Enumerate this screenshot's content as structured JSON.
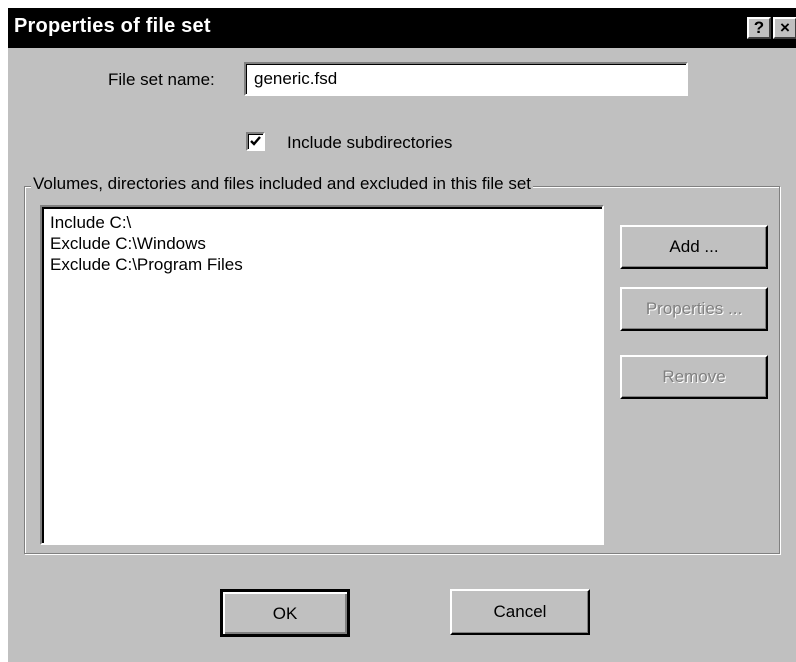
{
  "window": {
    "title": "Properties of file set",
    "help_label": "?",
    "close_label": "×"
  },
  "file_set_name": {
    "label": "File set name:",
    "value": "generic.fsd"
  },
  "include_subdirectories": {
    "label": "Include subdirectories",
    "checked": true
  },
  "group": {
    "legend": "Volumes, directories and files included and excluded in this file set",
    "items": [
      "Include C:\\",
      "Exclude C:\\Windows",
      "Exclude C:\\Program Files"
    ]
  },
  "buttons": {
    "add": "Add ...",
    "properties": "Properties ...",
    "remove": "Remove",
    "ok": "OK",
    "cancel": "Cancel"
  }
}
